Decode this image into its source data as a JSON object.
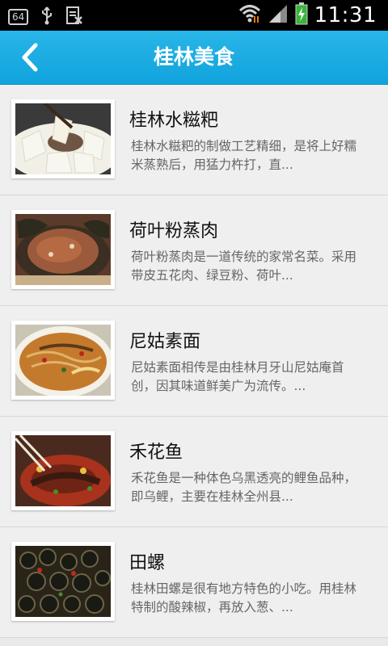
{
  "status_bar": {
    "badge": "64",
    "time": "11:31"
  },
  "header": {
    "title": "桂林美食",
    "back_icon": "chevron-left-icon"
  },
  "colors": {
    "header_bg": "#10a3dc",
    "list_bg": "#efefef",
    "title_text": "#111111",
    "desc_text": "#666666"
  },
  "items": [
    {
      "title": "桂林水糍粑",
      "desc_line1": "桂林水糍粑的制做工艺精细，是将上好糯",
      "desc_line2": "米蒸熟后，用猛力杵打，直..."
    },
    {
      "title": "荷叶粉蒸肉",
      "desc_line1": "荷叶粉蒸肉是一道传统的家常名菜。采用",
      "desc_line2": "带皮五花肉、绿豆粉、荷叶..."
    },
    {
      "title": "尼姑素面",
      "desc_line1": "尼姑素面相传是由桂林月牙山尼姑庵首",
      "desc_line2": "创，因其味道鲜美广为流传。..."
    },
    {
      "title": "禾花鱼",
      "desc_line1": "禾花鱼是一种体色乌黑透亮的鲤鱼品种，",
      "desc_line2": "即乌鲤，主要在桂林全州县..."
    },
    {
      "title": "田螺",
      "desc_line1": "桂林田螺是很有地方特色的小吃。用桂林",
      "desc_line2": "特制的酸辣椒，再放入葱、..."
    }
  ]
}
